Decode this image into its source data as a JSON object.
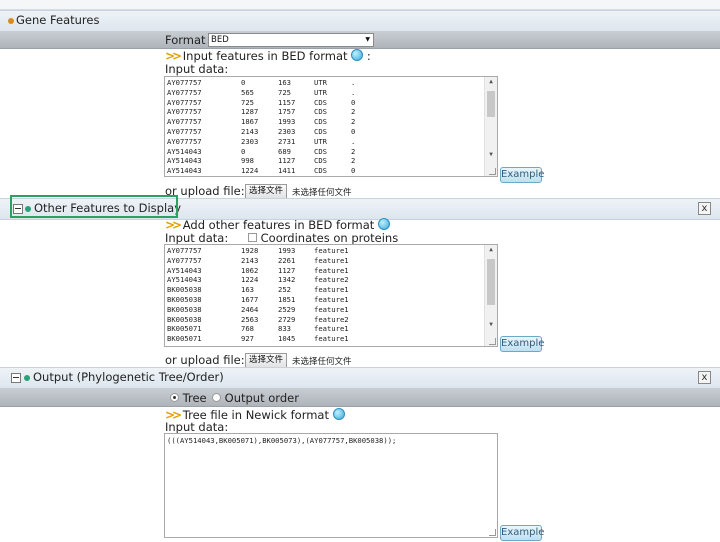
{
  "gene_features": {
    "title": "Gene Features",
    "format_label": "Format",
    "format_value": "BED",
    "input_heading": "Input features in BED format",
    "input_data_label": "Input data:",
    "rows": [
      [
        "AY077757",
        "0",
        "163",
        "UTR",
        "."
      ],
      [
        "AY077757",
        "565",
        "725",
        "UTR",
        "."
      ],
      [
        "AY077757",
        "725",
        "1157",
        "CDS",
        "0"
      ],
      [
        "AY077757",
        "1287",
        "1757",
        "CDS",
        "2"
      ],
      [
        "AY077757",
        "1867",
        "1993",
        "CDS",
        "2"
      ],
      [
        "AY077757",
        "2143",
        "2303",
        "CDS",
        "0"
      ],
      [
        "AY077757",
        "2303",
        "2731",
        "UTR",
        "."
      ],
      [
        "AY514043",
        "0",
        "689",
        "CDS",
        "2"
      ],
      [
        "AY514043",
        "998",
        "1127",
        "CDS",
        "2"
      ],
      [
        "AY514043",
        "1224",
        "1411",
        "CDS",
        "0"
      ]
    ],
    "upload_label": "or upload file:",
    "choose_file_button": "选择文件",
    "no_file_text": "未选择任何文件",
    "example_button": "Example"
  },
  "other_features": {
    "title": "Other Features to Display",
    "input_heading": "Add other features in BED format",
    "input_data_label": "Input data:",
    "coords_on_proteins_label": "Coordinates on proteins",
    "rows": [
      [
        "AY077757",
        "1928",
        "1993",
        "feature1"
      ],
      [
        "AY077757",
        "2143",
        "2261",
        "feature1"
      ],
      [
        "AY514043",
        "1062",
        "1127",
        "feature1"
      ],
      [
        "AY514043",
        "1224",
        "1342",
        "feature2"
      ],
      [
        "BK005038",
        "163",
        "252",
        "feature1"
      ],
      [
        "BK005038",
        "1677",
        "1851",
        "feature1"
      ],
      [
        "BK005038",
        "2464",
        "2529",
        "feature1"
      ],
      [
        "BK005038",
        "2563",
        "2729",
        "feature2"
      ],
      [
        "BK005071",
        "768",
        "833",
        "feature1"
      ],
      [
        "BK005071",
        "927",
        "1045",
        "feature1"
      ]
    ],
    "upload_label": "or upload file:",
    "choose_file_button": "选择文件",
    "no_file_text": "未选择任何文件",
    "example_button": "Example"
  },
  "output": {
    "title": "Output (Phylogenetic Tree/Order)",
    "tree_option": "Tree",
    "order_option": "Output order",
    "input_heading": "Tree file in Newick format",
    "input_data_label": "Input data:",
    "newick_value": "(((AY514043,BK005071),BK005073),(AY077757,BK005038));",
    "example_button": "Example"
  },
  "icons": {
    "section_dot_orange": "orange-dot-icon",
    "section_dot_green": "green-dot-icon",
    "help": "help-icon",
    "chevrons": "double-chevron-icon"
  },
  "colors": {
    "highlight": "#2ba163",
    "section_bar": "#dde6ee",
    "example_button": "#bfdff0"
  }
}
